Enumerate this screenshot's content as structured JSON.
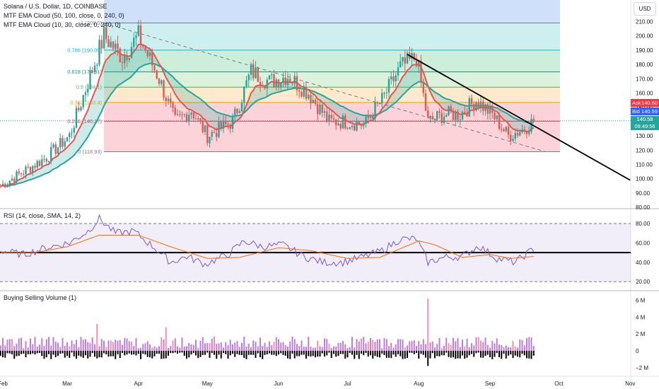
{
  "legends": {
    "main": "Solana / U.S. Dollar, 1D, COINBASE",
    "ema1": "MTF EMA Cloud (50, 100, close, 0, 240, 0)",
    "ema2": "MTF EMA Cloud (10, 30, close, 0, 240, 0)",
    "rsi": "RSI (14, close, SMA, 14, 2)",
    "volume": "Buying Selling Volume (1)"
  },
  "currency_button": "USD",
  "price_labels": {
    "ask_tag": "Ask",
    "ask_value": "140.60",
    "bid_tag": "Bid",
    "bid_value": "140.59",
    "last_value": "140.58",
    "countdown": "09:49:56"
  },
  "colors": {
    "bull": "#26a69a",
    "bear": "#ef5350",
    "ema_slow": "#26a69a",
    "ema_fast": "#ef5350",
    "rsi_line": "#7e57c2",
    "rsi_ma": "#ff6d00",
    "vol_buy": "#c17bd9",
    "vol_sell": "#000000",
    "vol_hi": "#f48fb1"
  },
  "chart_data": [
    {
      "type": "candlestick",
      "title": "Solana / U.S. Dollar, 1D, COINBASE",
      "x_ticks": [
        "Feb",
        "Mar",
        "Apr",
        "May",
        "Jun",
        "Jul",
        "Aug",
        "Sep",
        "Oct",
        "Nov"
      ],
      "y_ticks": [
        "210.00",
        "200.00",
        "190.00",
        "180.00",
        "170.00",
        "160.00",
        "150.00",
        "140.00",
        "130.00",
        "120.00",
        "110.00",
        "100.00",
        "90.00",
        "80.00"
      ],
      "ylim": [
        78,
        222
      ],
      "fibonacci": [
        {
          "level": "1",
          "price": 209.0,
          "label": "1 (209.0)",
          "fill": "#e3e3e3",
          "line": "#787b86"
        },
        {
          "level": "0.786",
          "price": 190.0,
          "label": "0.786 (190.00)",
          "fill": "#cdeff0",
          "line": "#00bcd4"
        },
        {
          "level": "0.618",
          "price": 174.81,
          "label": "0.618 (174.81)",
          "fill": "#cdeedb",
          "line": "#089981"
        },
        {
          "level": "0.5",
          "price": 164.1,
          "label": "0.5 (164.1)",
          "fill": "#ddf2dd",
          "line": "#4caf50"
        },
        {
          "level": "0.382",
          "price": 153.4,
          "label": "0.382 (153.4)",
          "fill": "#fdeacc",
          "line": "#ff9800"
        },
        {
          "level": "0.236",
          "price": 140.27,
          "label": "0.236 (140.27)",
          "fill": "#fbd3d8",
          "line": "#f23645"
        },
        {
          "level": "0",
          "price": 118.93,
          "label": "0 (118.93)",
          "fill": null,
          "line": "#787b86"
        }
      ],
      "fib_top_band": {
        "price_top": 222.0,
        "fill": "#cfe0fb"
      },
      "trendlines": [
        {
          "style": "dashed",
          "color": "#787b86",
          "from": [
            "Mar 17",
            209.0
          ],
          "to": [
            "Sep 25",
            119.0
          ]
        },
        {
          "style": "solid",
          "color": "#000000",
          "from": [
            "Jul 27",
            187.0
          ],
          "to": [
            "Nov 1",
            99.0
          ]
        }
      ],
      "current_price": 140.58,
      "key_points": [
        [
          "Jan 31",
          95
        ],
        [
          "Feb 20",
          115
        ],
        [
          "Mar 2",
          130
        ],
        [
          "Mar 17",
          200
        ],
        [
          "Mar 25",
          185
        ],
        [
          "Apr 1",
          200
        ],
        [
          "Apr 10",
          170
        ],
        [
          "Apr 17",
          140
        ],
        [
          "Apr 24",
          148
        ],
        [
          "May 1",
          130
        ],
        [
          "May 12",
          140
        ],
        [
          "May 20",
          175
        ],
        [
          "May 28",
          168
        ],
        [
          "Jun 5",
          172
        ],
        [
          "Jun 14",
          160
        ],
        [
          "Jun 23",
          140
        ],
        [
          "Jun 30",
          140
        ],
        [
          "Jul 8",
          138
        ],
        [
          "Jul 16",
          155
        ],
        [
          "Jul 24",
          178
        ],
        [
          "Jul 31",
          185
        ],
        [
          "Aug 5",
          140
        ],
        [
          "Aug 12",
          145
        ],
        [
          "Aug 19",
          145
        ],
        [
          "Aug 26",
          155
        ],
        [
          "Sep 2",
          145
        ],
        [
          "Sep 9",
          130
        ],
        [
          "Sep 16",
          135
        ],
        [
          "Sep 20",
          140.58
        ]
      ]
    },
    {
      "type": "line",
      "title": "RSI (14, close, SMA, 14, 2)",
      "y_ticks": [
        "80.00",
        "60.00",
        "40.00",
        "20.00"
      ],
      "ylim": [
        15,
        85
      ],
      "bands": {
        "upper": 80,
        "lower": 20,
        "middle_line": 50
      },
      "rsi_points": [
        [
          "Jan 31",
          52
        ],
        [
          "Feb 10",
          48
        ],
        [
          "Feb 20",
          55
        ],
        [
          "Mar 2",
          60
        ],
        [
          "Mar 10",
          72
        ],
        [
          "Mar 15",
          85
        ],
        [
          "Mar 22",
          70
        ],
        [
          "Mar 30",
          72
        ],
        [
          "Apr 8",
          55
        ],
        [
          "Apr 15",
          40
        ],
        [
          "Apr 22",
          46
        ],
        [
          "Apr 30",
          38
        ],
        [
          "May 10",
          48
        ],
        [
          "May 17",
          62
        ],
        [
          "May 25",
          56
        ],
        [
          "Jun 3",
          58
        ],
        [
          "Jun 12",
          46
        ],
        [
          "Jun 20",
          40
        ],
        [
          "Jun 29",
          40
        ],
        [
          "Jul 7",
          45
        ],
        [
          "Jul 16",
          52
        ],
        [
          "Jul 24",
          64
        ],
        [
          "Jul 31",
          64
        ],
        [
          "Aug 5",
          40
        ],
        [
          "Aug 12",
          45
        ],
        [
          "Aug 20",
          46
        ],
        [
          "Aug 27",
          57
        ],
        [
          "Sep 4",
          44
        ],
        [
          "Sep 12",
          40
        ],
        [
          "Sep 20",
          54
        ]
      ],
      "ma_points": [
        [
          "Jan 31",
          50
        ],
        [
          "Feb 15",
          50
        ],
        [
          "Mar 1",
          56
        ],
        [
          "Mar 15",
          68
        ],
        [
          "Apr 1",
          68
        ],
        [
          "Apr 15",
          56
        ],
        [
          "May 1",
          44
        ],
        [
          "May 15",
          45
        ],
        [
          "Jun 1",
          55
        ],
        [
          "Jun 15",
          52
        ],
        [
          "Jul 1",
          44
        ],
        [
          "Jul 15",
          45
        ],
        [
          "Aug 1",
          62
        ],
        [
          "Aug 8",
          58
        ],
        [
          "Aug 20",
          45
        ],
        [
          "Sep 1",
          48
        ],
        [
          "Sep 10",
          44
        ],
        [
          "Sep 20",
          46
        ]
      ]
    },
    {
      "type": "bar",
      "title": "Buying Selling Volume (1)",
      "y_ticks": [
        "6 M",
        "4 M",
        "2 M",
        "0",
        "−2 M"
      ],
      "ylim": [
        -2.5,
        6.5
      ],
      "notable_bars": [
        {
          "date": "Aug 5",
          "buy": 6.2,
          "sell": -1.8
        },
        {
          "date": "Mar 14",
          "buy": 3.2,
          "sell": -0.9
        },
        {
          "date": "Apr 13",
          "buy": 2.8,
          "sell": -0.9
        }
      ]
    }
  ]
}
